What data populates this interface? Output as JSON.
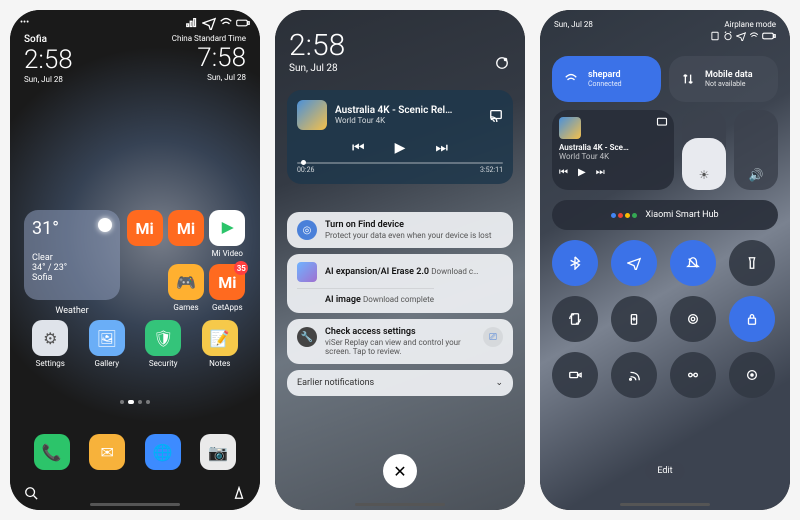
{
  "phone1": {
    "status_left_indicator": "•••",
    "status_icons": [
      "signal-icon",
      "airplane-icon",
      "wifi-icon",
      "battery-icon"
    ],
    "clock_left": {
      "city": "Sofia",
      "time": "2:58",
      "date": "Sun, Jul 28"
    },
    "clock_right": {
      "tz": "China Standard Time",
      "time": "7:58",
      "date": "Sun, Jul 28"
    },
    "weather": {
      "temp": "31°",
      "cond": "Clear",
      "range": "34° / 23°",
      "city": "Sofia",
      "label": "Weather"
    },
    "apps_row1": [
      {
        "name": "Mi",
        "color": "#ff6a1f",
        "label": ""
      },
      {
        "name": "Mi",
        "color": "#ff6a1f",
        "label": ""
      },
      {
        "name": "Mi Video",
        "color": "#ffffff",
        "label": "Mi Video"
      }
    ],
    "apps_row2": [
      {
        "name": "Games",
        "color": "#ffb030",
        "label": "Games"
      },
      {
        "name": "GetApps",
        "color": "#ff6a1f",
        "label": "GetApps",
        "badge": "35"
      }
    ],
    "apps_row3": [
      {
        "name": "Settings",
        "color": "#dfe3ea",
        "label": "Settings"
      },
      {
        "name": "Gallery",
        "color": "#6aaef7",
        "label": "Gallery"
      },
      {
        "name": "Security",
        "color": "#34c47a",
        "label": "Security"
      },
      {
        "name": "Notes",
        "color": "#f6c94a",
        "label": "Notes"
      }
    ],
    "dock": [
      {
        "name": "Phone",
        "color": "#2cc46a"
      },
      {
        "name": "Messages",
        "color": "#f7b23b"
      },
      {
        "name": "Browser",
        "color": "#3d8bff"
      },
      {
        "name": "Camera",
        "color": "#eaeaea"
      }
    ]
  },
  "phone2": {
    "time": "2:58",
    "date": "Sun, Jul 28",
    "media": {
      "title": "Australia 4K - Scenic Rel…",
      "subtitle": "World Tour 4K",
      "elapsed": "00:26",
      "total": "3:52:11"
    },
    "notifs": [
      {
        "icon": "radar",
        "title": "Turn on Find device",
        "body": "Protect your data even when your device is lost"
      }
    ],
    "ai_notif": {
      "line1_title": "AI expansion/AI Erase 2.0",
      "line1_body": "Download c…",
      "line2_title": "AI image",
      "line2_body": "Download complete"
    },
    "access_notif": {
      "title": "Check access settings",
      "body": "viSer Replay can view and control your screen. Tap to review."
    },
    "earlier": "Earlier notifications"
  },
  "phone3": {
    "date": "Sun, Jul 28",
    "mode": "Airplane mode",
    "tiles": [
      {
        "title": "shepard",
        "sub": "Connected",
        "on": true,
        "icon": "wifi"
      },
      {
        "title": "Mobile data",
        "sub": "Not available",
        "on": false,
        "icon": "data"
      }
    ],
    "media": {
      "title": "Australia 4K - Sce…",
      "sub": "World Tour 4K"
    },
    "hub": "Xiaomi Smart Hub",
    "toggles": [
      {
        "name": "bluetooth",
        "on": true
      },
      {
        "name": "airplane",
        "on": true
      },
      {
        "name": "dnd",
        "on": true
      },
      {
        "name": "flashlight",
        "on": false
      },
      {
        "name": "autorotate",
        "on": false
      },
      {
        "name": "battery",
        "on": false
      },
      {
        "name": "darkmode",
        "on": false
      },
      {
        "name": "lock",
        "on": true
      },
      {
        "name": "record",
        "on": false
      },
      {
        "name": "cast",
        "on": false
      },
      {
        "name": "hotspot",
        "on": false
      },
      {
        "name": "screenshot",
        "on": false
      }
    ],
    "edit": "Edit"
  }
}
